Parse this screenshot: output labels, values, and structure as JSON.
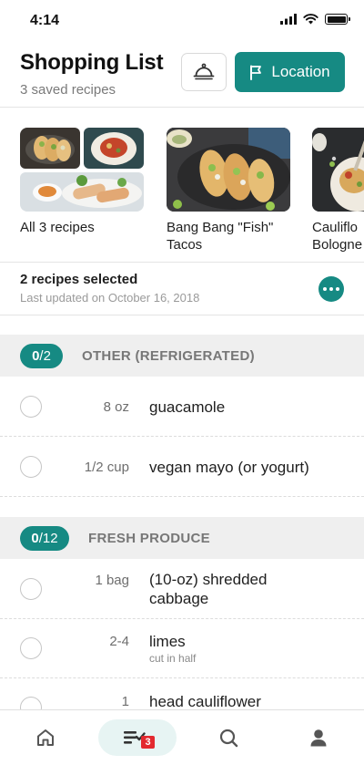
{
  "status_bar": {
    "time": "4:14"
  },
  "header": {
    "title": "Shopping List",
    "subtitle": "3 saved recipes",
    "location_label": "Location"
  },
  "recipes": [
    {
      "name": "All 3 recipes"
    },
    {
      "name": "Bang Bang \"Fish\"\nTacos"
    },
    {
      "name": "Cauliflo\nBologne"
    }
  ],
  "selection": {
    "title": "2 recipes selected",
    "updated": "Last updated on October 16, 2018"
  },
  "sections": [
    {
      "checked": "0",
      "total": "/2",
      "title": "OTHER (REFRIGERATED)",
      "items": [
        {
          "qty": "8 oz",
          "name": "guacamole",
          "note": ""
        },
        {
          "qty": "1/2 cup",
          "name": "vegan mayo (or yogurt)",
          "note": ""
        }
      ]
    },
    {
      "checked": "0",
      "total": "/12",
      "title": "FRESH PRODUCE",
      "items": [
        {
          "qty": "1 bag",
          "name": "(10-oz) shredded cabbage",
          "note": ""
        },
        {
          "qty": "2-4",
          "name": "limes",
          "note": "cut in half"
        },
        {
          "qty": "1",
          "name": "head cauliflower",
          "note": ""
        }
      ]
    }
  ],
  "tab_bar": {
    "badge_count": "3",
    "tabs": [
      "home-icon",
      "shopping-list-icon",
      "search-icon",
      "profile-icon"
    ]
  },
  "colors": {
    "accent": "#168a83",
    "badge": "#e3292f",
    "section_bg": "#efefef"
  }
}
